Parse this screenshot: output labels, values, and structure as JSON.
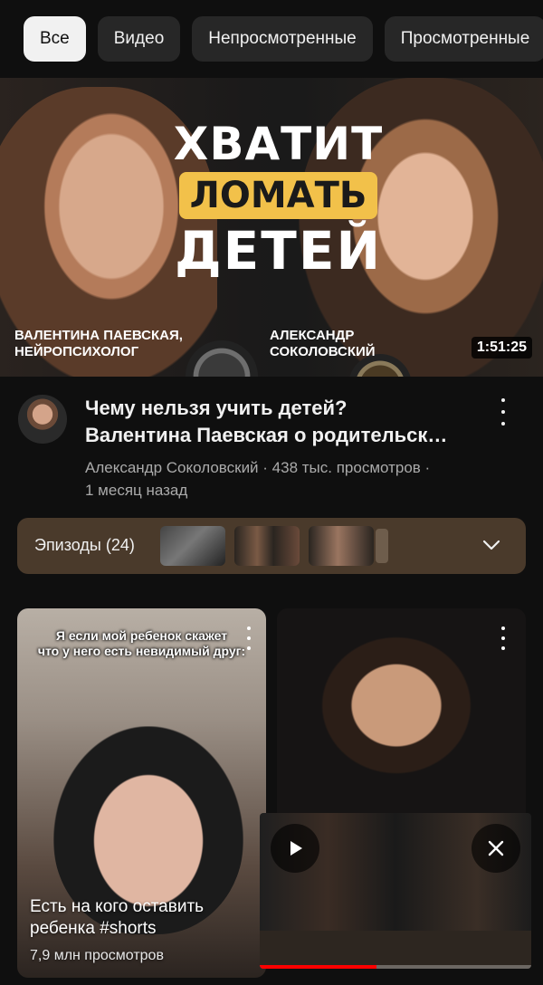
{
  "chips": [
    {
      "label": "Все",
      "active": true
    },
    {
      "label": "Видео",
      "active": false
    },
    {
      "label": "Непросмотренные",
      "active": false
    },
    {
      "label": "Просмотренные",
      "active": false
    }
  ],
  "hero": {
    "title_line1": "ХВАТИТ",
    "title_line2": "ЛОМАТЬ",
    "title_line3": "ДЕТЕЙ",
    "caption_left_line1": "ВАЛЕНТИНА ПАЕВСКАЯ,",
    "caption_left_line2": "НЕЙРОПСИХОЛОГ",
    "caption_right_line1": "АЛЕКСАНДР",
    "caption_right_line2": "СОКОЛОВСКИЙ",
    "duration": "1:51:25",
    "accent_color": "#f2c14a"
  },
  "video": {
    "title_line1": "Чему нельзя учить детей?",
    "title_line2": "Валентина Паевская о родительск…",
    "meta_line1": "Александр Соколовский · 438 тыс. просмотров ·",
    "meta_line2": "1 месяц назад"
  },
  "episodes": {
    "label": "Эпизоды (24)"
  },
  "shorts": [
    {
      "overlay_line1": "Я если мой ребенок скажет",
      "overlay_line2": "что у него есть невидимый друг:",
      "title_line1": "Есть на кого оставить",
      "title_line2": "ребенка #shorts",
      "views": "7,9 млн просмотров"
    }
  ],
  "miniplayer": {
    "progress_fraction": 0.43,
    "progress_color": "#ff0000"
  }
}
